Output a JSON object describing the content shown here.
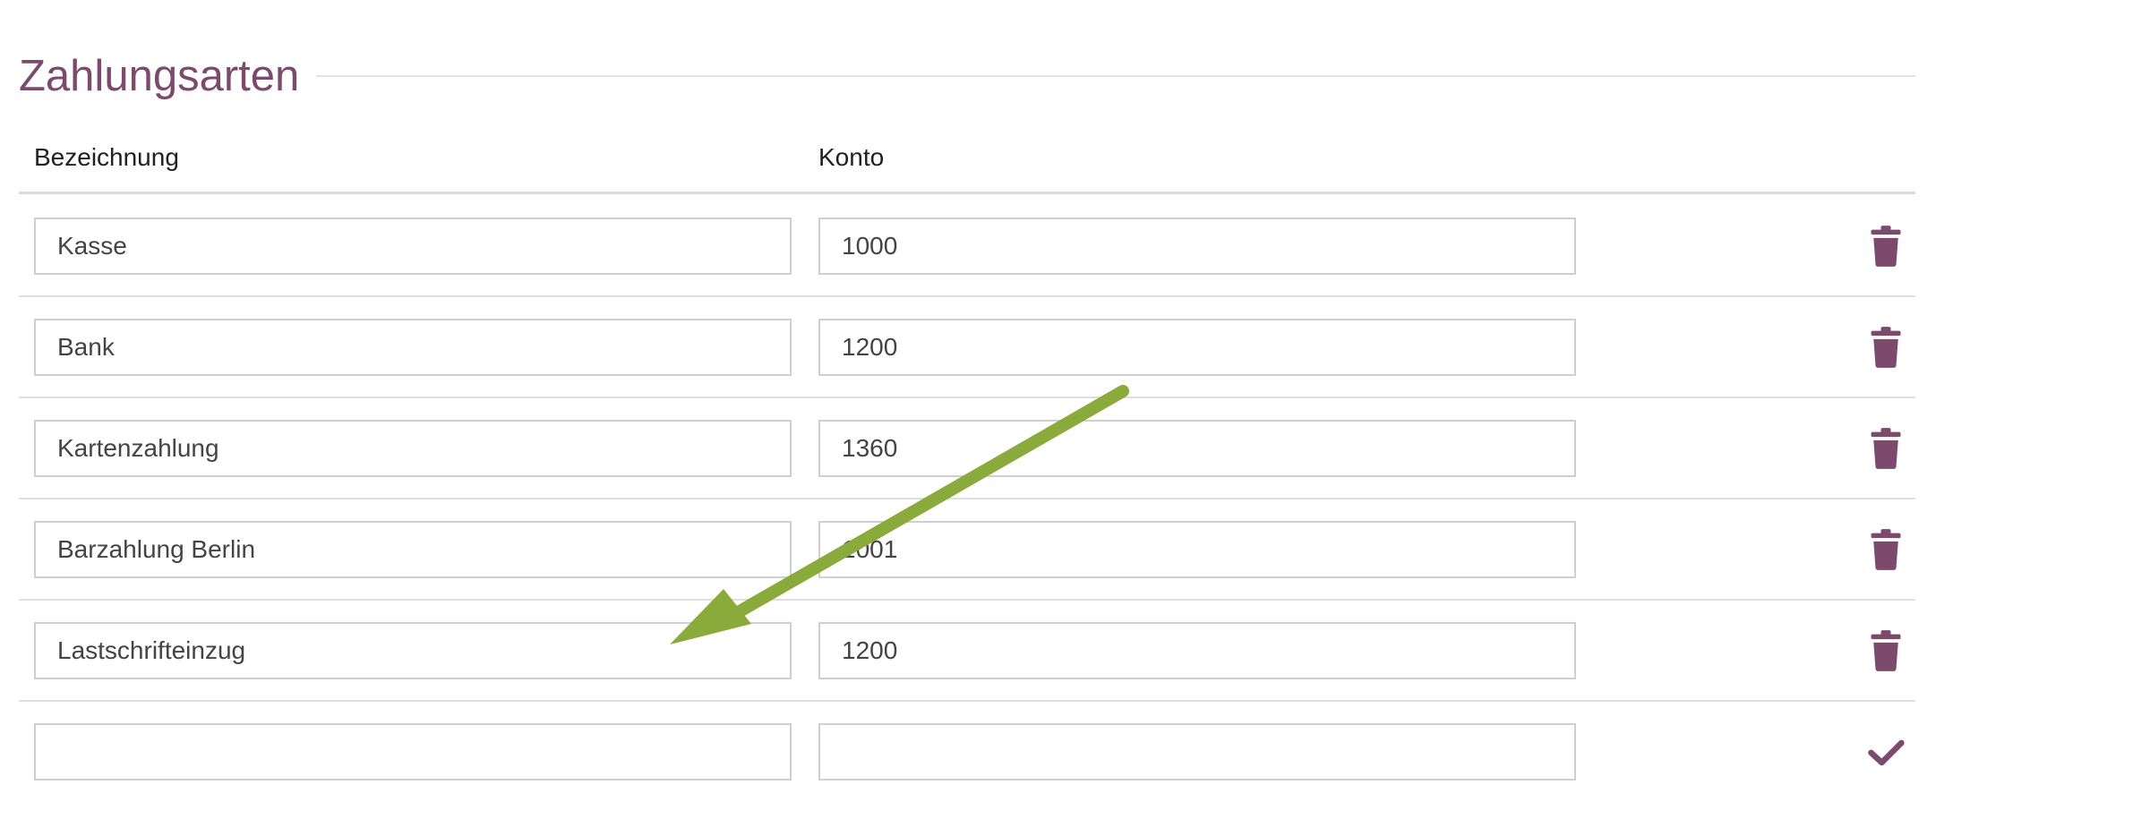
{
  "section": {
    "title": "Zahlungsarten"
  },
  "columns": {
    "name": "Bezeichnung",
    "konto": "Konto"
  },
  "rows": [
    {
      "name": "Kasse",
      "konto": "1000",
      "action": "trash-icon"
    },
    {
      "name": "Bank",
      "konto": "1200",
      "action": "trash-icon"
    },
    {
      "name": "Kartenzahlung",
      "konto": "1360",
      "action": "trash-icon"
    },
    {
      "name": "Barzahlung Berlin",
      "konto": "1001",
      "action": "trash-icon"
    },
    {
      "name": "Lastschrifteinzug",
      "konto": "1200",
      "action": "trash-icon"
    },
    {
      "name": "",
      "konto": "",
      "action": "check-icon"
    }
  ],
  "colors": {
    "accent": "#7b4a6d",
    "annotation_arrow": "#8aaa3c"
  }
}
